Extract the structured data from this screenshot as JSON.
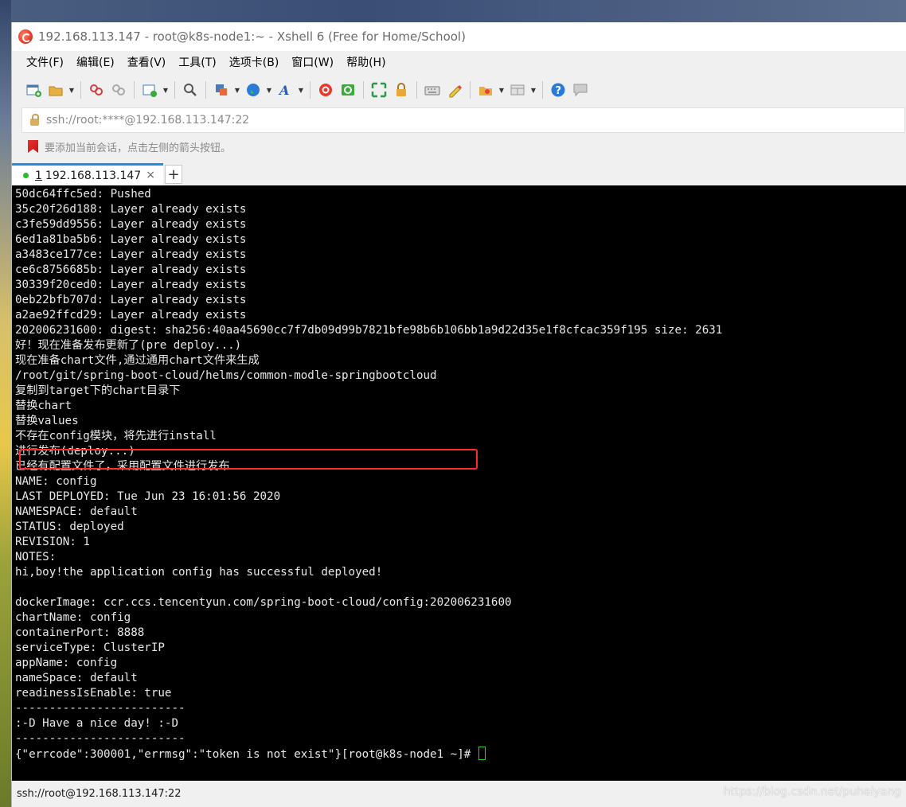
{
  "window": {
    "title": "192.168.113.147 - root@k8s-node1:~ - Xshell 6 (Free for Home/School)"
  },
  "menubar": {
    "items": [
      "文件(F)",
      "编辑(E)",
      "查看(V)",
      "工具(T)",
      "选项卡(B)",
      "窗口(W)",
      "帮助(H)"
    ]
  },
  "toolbar": {
    "icons": [
      "new-session-icon",
      "open-folder-icon",
      "connect-icon",
      "disconnect-icon",
      "new-tab-icon",
      "find-icon",
      "properties-icon",
      "globe-icon",
      "font-icon",
      "xshell-icon",
      "xftp-icon",
      "fullscreen-icon",
      "lock-icon",
      "keyboard-icon",
      "highlight-icon",
      "compose-icon",
      "layout-icon",
      "help-icon",
      "chat-icon"
    ]
  },
  "address": {
    "value": "ssh://root:****@192.168.113.147:22"
  },
  "hint": {
    "text": "要添加当前会话，点击左侧的箭头按钮。"
  },
  "tabs": [
    {
      "number": "1",
      "label": "192.168.113.147",
      "status_color": "#22c022"
    }
  ],
  "terminal": {
    "lines": [
      "50dc64ffc5ed: Pushed",
      "35c20f26d188: Layer already exists",
      "c3fe59dd9556: Layer already exists",
      "6ed1a81ba5b6: Layer already exists",
      "a3483ce177ce: Layer already exists",
      "ce6c8756685b: Layer already exists",
      "30339f20ced0: Layer already exists",
      "0eb22bfb707d: Layer already exists",
      "a2ae92ffcd29: Layer already exists",
      "202006231600: digest: sha256:40aa45690cc7f7db09d99b7821bfe98b6b106bb1a9d22d35e1f8cfcac359f195 size: 2631",
      "好！现在准备发布更新了(pre deploy...)",
      "现在准备chart文件,通过通用chart文件来生成",
      "/root/git/spring-boot-cloud/helms/common-modle-springbootcloud",
      "复制到target下的chart目录下",
      "替换chart",
      "替换values",
      "不存在config模块，将先进行install",
      "进行发布(deploy...)",
      "已经有配置文件了，采用配置文件进行发布",
      "NAME: config",
      "LAST DEPLOYED: Tue Jun 23 16:01:56 2020",
      "NAMESPACE: default",
      "STATUS: deployed",
      "REVISION: 1",
      "NOTES:",
      "hi,boy!the application config has successful deployed!",
      "",
      "dockerImage: ccr.ccs.tencentyun.com/spring-boot-cloud/config:202006231600",
      "chartName: config",
      "containerPort: 8888",
      "serviceType: ClusterIP",
      "appName: config",
      "nameSpace: default",
      "readinessIsEnable: true",
      "-------------------------",
      ":-D Have a nice day! :-D",
      "-------------------------",
      "{\"errcode\":300001,\"errmsg\":\"token is not exist\"}[root@k8s-node1 ~]# "
    ]
  },
  "statusbar": {
    "text": "ssh://root@192.168.113.147:22",
    "watermark": "https://blog.csdn.net/puhaiyang"
  },
  "colors": {
    "terminal_bg": "#000000",
    "terminal_fg": "#e8e8e8",
    "highlight_box": "#ff2a2a",
    "cursor": "#2ad02a",
    "tab_accent": "#1e8fe8"
  }
}
